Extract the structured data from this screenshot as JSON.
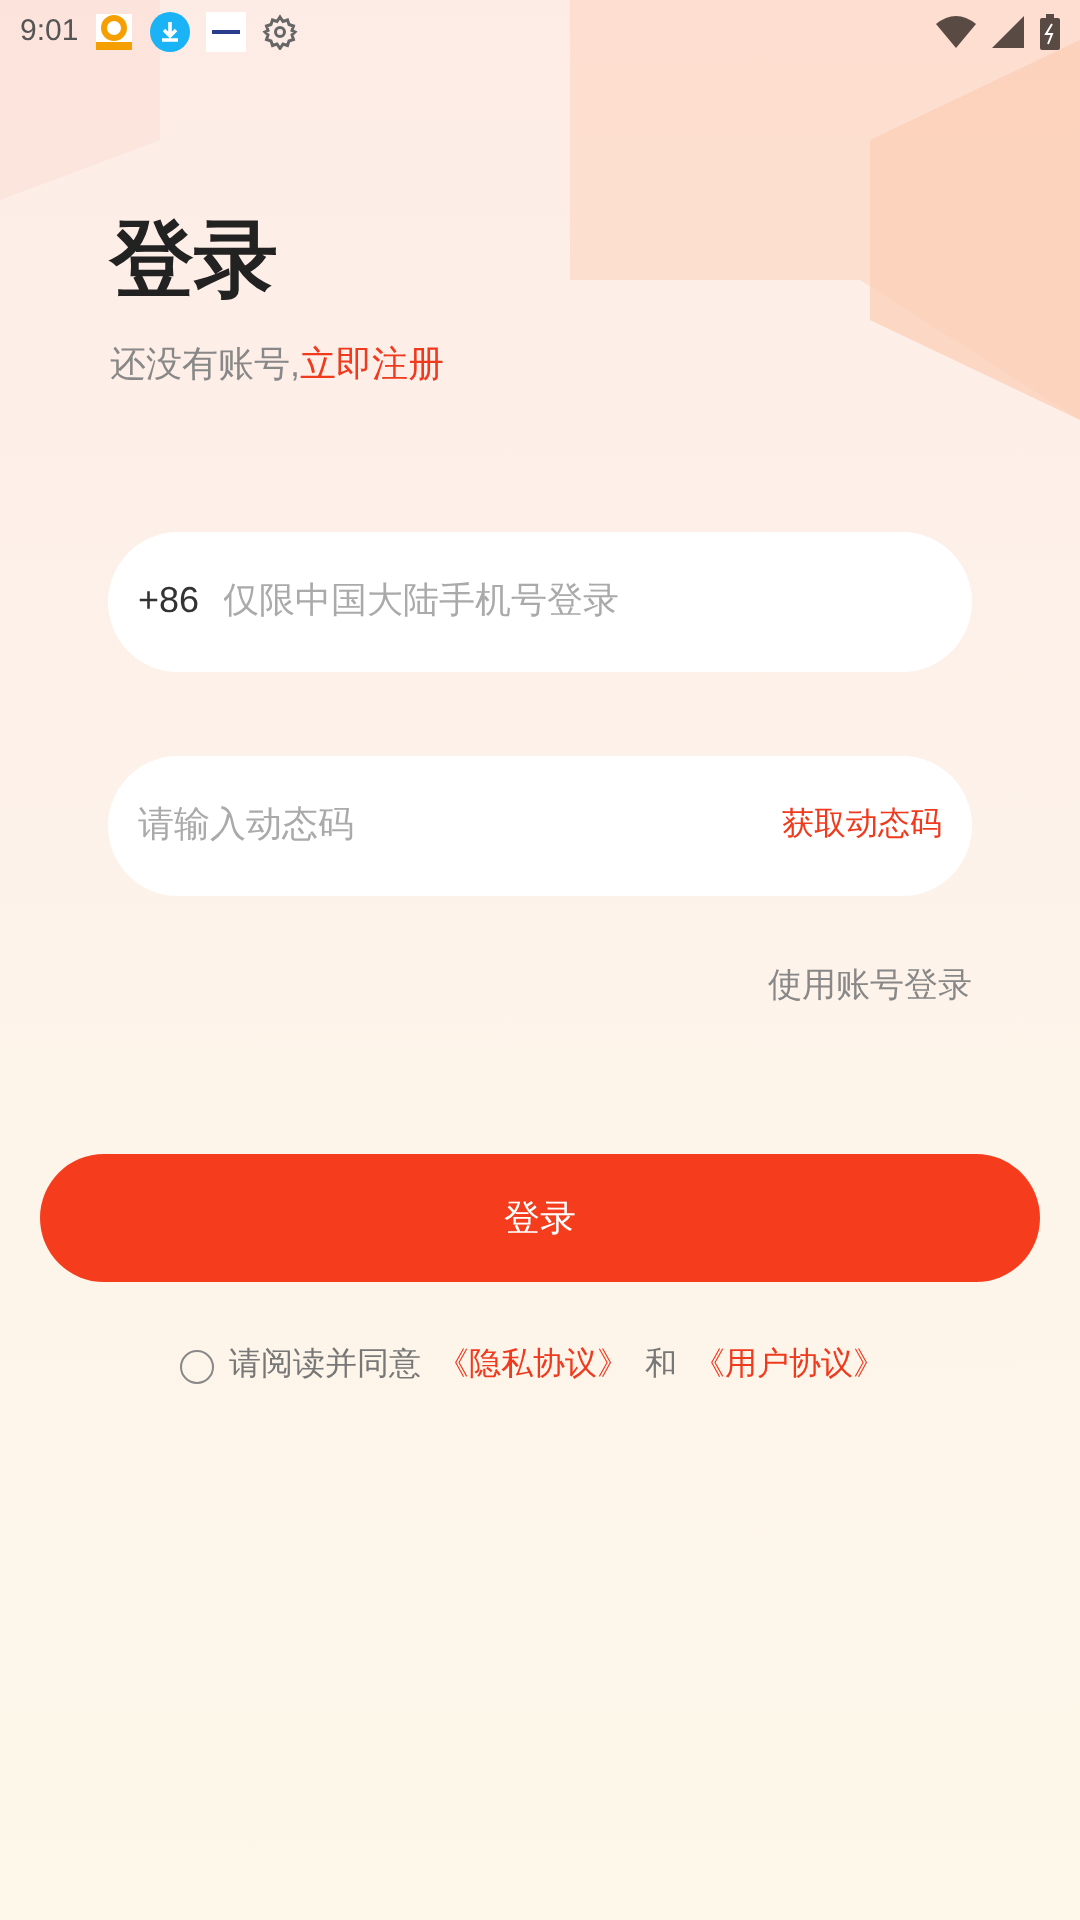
{
  "status_bar": {
    "time": "9:01"
  },
  "title": "登录",
  "subtitle": {
    "text": "还没有账号,",
    "link": "立即注册"
  },
  "phone_field": {
    "prefix": "+86",
    "placeholder": "仅限中国大陆手机号登录"
  },
  "code_field": {
    "placeholder": "请输入动态码",
    "action": "获取动态码"
  },
  "account_login_link": "使用账号登录",
  "login_button": "登录",
  "agreement": {
    "checked": false,
    "text": "请阅读并同意",
    "privacy_link": "《隐私协议》",
    "conjunction": "和",
    "user_link": "《用户协议》"
  }
}
